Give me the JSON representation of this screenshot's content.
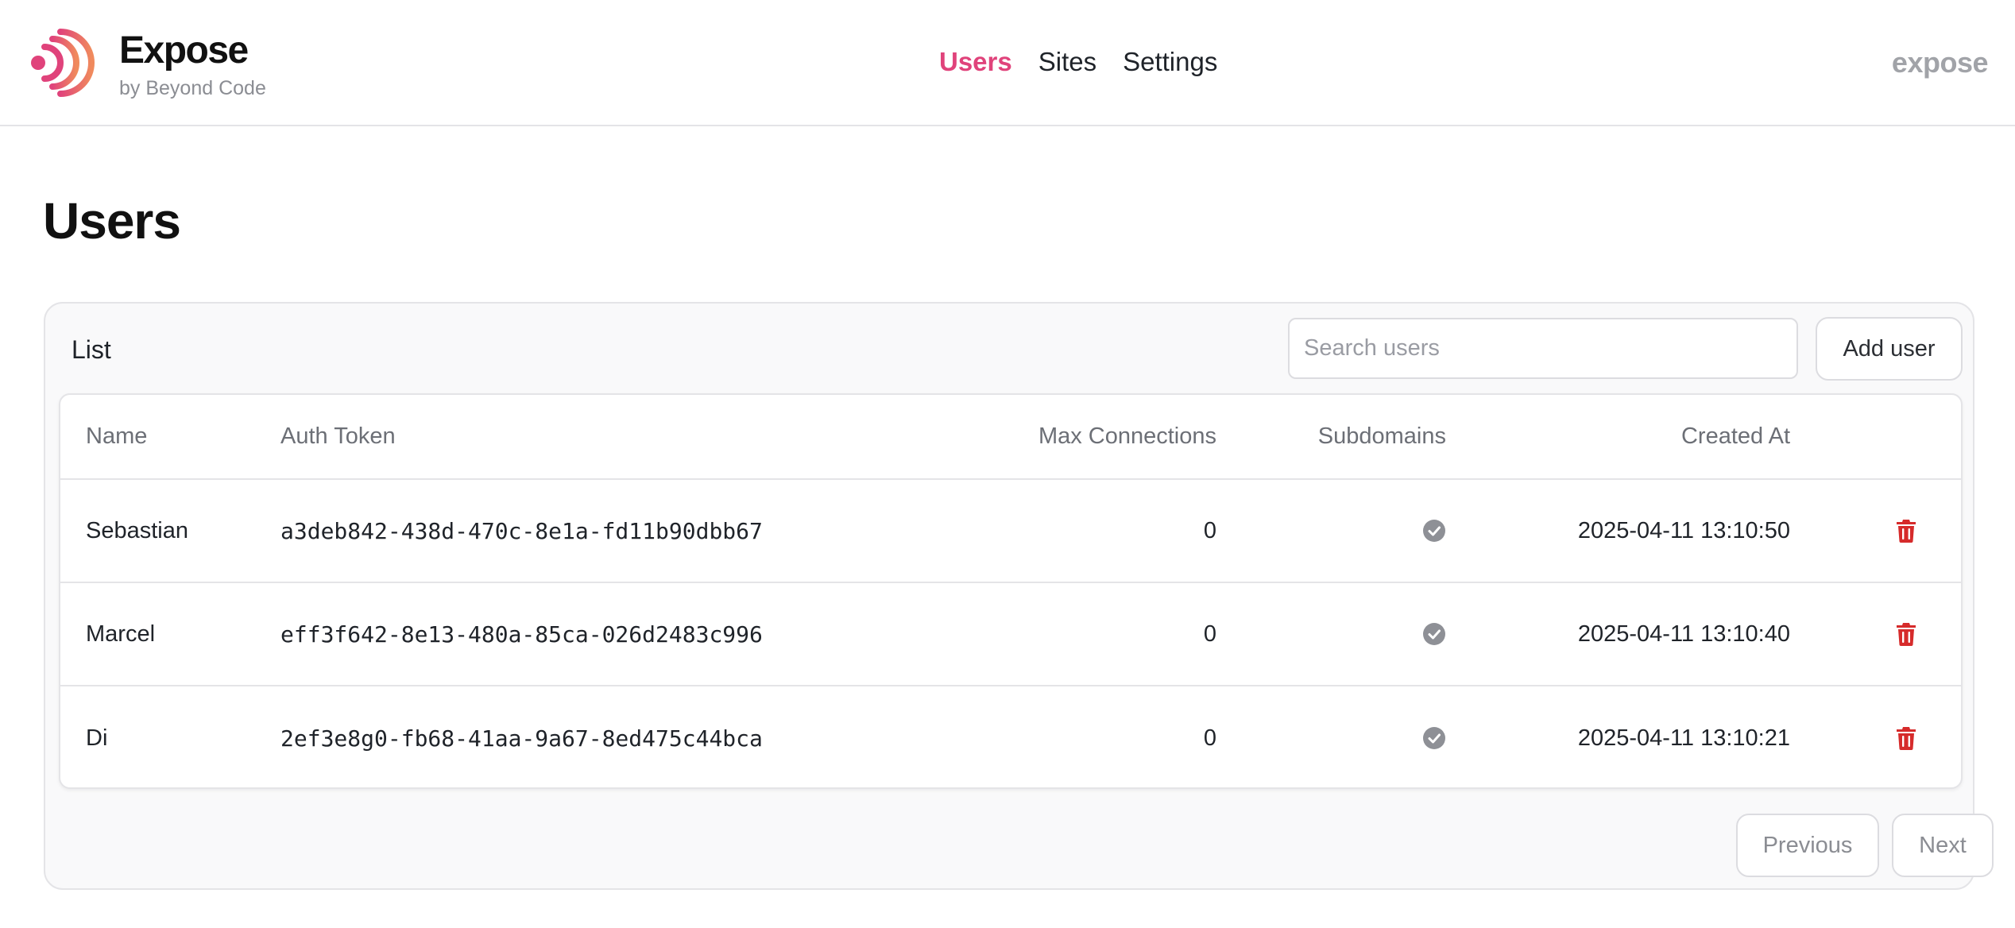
{
  "app": {
    "name": "Expose",
    "subtitle": "by Beyond Code",
    "right_label": "expose",
    "accent_color": "#e0437b"
  },
  "nav": {
    "items": [
      {
        "label": "Users",
        "active": true
      },
      {
        "label": "Sites",
        "active": false
      },
      {
        "label": "Settings",
        "active": false
      }
    ]
  },
  "page": {
    "title": "Users"
  },
  "list": {
    "title": "List",
    "search_placeholder": "Search users",
    "add_label": "Add user",
    "columns": {
      "name": "Name",
      "token": "Auth Token",
      "max": "Max Connections",
      "subdomains": "Subdomains",
      "created": "Created At"
    },
    "rows": [
      {
        "name": "Sebastian",
        "token": "a3deb842-438d-470c-8e1a-fd11b90dbb67",
        "max": "0",
        "subdomains_icon": "check-circle-icon",
        "created": "2025-04-11 13:10:50",
        "delete_icon": "trash-icon"
      },
      {
        "name": "Marcel",
        "token": "eff3f642-8e13-480a-85ca-026d2483c996",
        "max": "0",
        "subdomains_icon": "check-circle-icon",
        "created": "2025-04-11 13:10:40",
        "delete_icon": "trash-icon"
      },
      {
        "name": "Di",
        "token": "2ef3e8g0-fb68-41aa-9a67-8ed475c44bca",
        "max": "0",
        "subdomains_icon": "check-circle-icon",
        "created": "2025-04-11 13:10:21",
        "delete_icon": "trash-icon"
      }
    ],
    "pagination": {
      "previous": "Previous",
      "next": "Next"
    }
  }
}
